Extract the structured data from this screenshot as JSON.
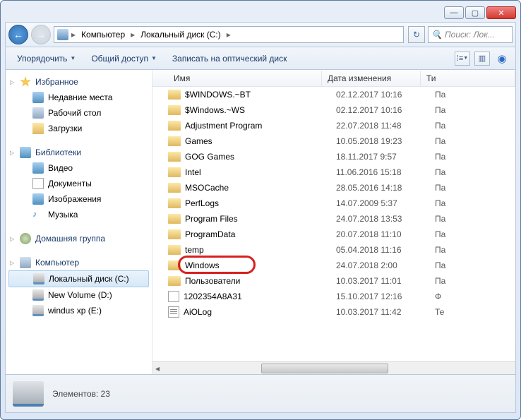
{
  "breadcrumbs": [
    "Компьютер",
    "Локальный диск (C:)"
  ],
  "search_placeholder": "Поиск: Лок...",
  "toolbar": {
    "organize": "Упорядочить",
    "share": "Общий доступ",
    "burn": "Записать на оптический диск"
  },
  "sidebar": {
    "favorites": {
      "label": "Избранное",
      "items": [
        "Недавние места",
        "Рабочий стол",
        "Загрузки"
      ]
    },
    "libraries": {
      "label": "Библиотеки",
      "items": [
        "Видео",
        "Документы",
        "Изображения",
        "Музыка"
      ]
    },
    "homegroup": {
      "label": "Домашняя группа"
    },
    "computer": {
      "label": "Компьютер",
      "items": [
        "Локальный диск (C:)",
        "New Volume (D:)",
        "windus xp (E:)"
      ]
    }
  },
  "columns": {
    "name": "Имя",
    "date": "Дата изменения",
    "type": "Ти"
  },
  "files": [
    {
      "name": "$WINDOWS.~BT",
      "date": "02.12.2017 10:16",
      "type": "Па",
      "icon": "fold"
    },
    {
      "name": "$Windows.~WS",
      "date": "02.12.2017 10:16",
      "type": "Па",
      "icon": "fold"
    },
    {
      "name": "Adjustment Program",
      "date": "22.07.2018 11:48",
      "type": "Па",
      "icon": "fold"
    },
    {
      "name": "Games",
      "date": "10.05.2018 19:23",
      "type": "Па",
      "icon": "fold"
    },
    {
      "name": "GOG Games",
      "date": "18.11.2017 9:57",
      "type": "Па",
      "icon": "fold"
    },
    {
      "name": "Intel",
      "date": "11.06.2016 15:18",
      "type": "Па",
      "icon": "fold"
    },
    {
      "name": "MSOCache",
      "date": "28.05.2016 14:18",
      "type": "Па",
      "icon": "fold"
    },
    {
      "name": "PerfLogs",
      "date": "14.07.2009 5:37",
      "type": "Па",
      "icon": "fold"
    },
    {
      "name": "Program Files",
      "date": "24.07.2018 13:53",
      "type": "Па",
      "icon": "fold"
    },
    {
      "name": "ProgramData",
      "date": "20.07.2018 11:10",
      "type": "Па",
      "icon": "fold"
    },
    {
      "name": "temp",
      "date": "05.04.2018 11:16",
      "type": "Па",
      "icon": "fold"
    },
    {
      "name": "Windows",
      "date": "24.07.2018 2:00",
      "type": "Па",
      "icon": "fold",
      "highlight": true
    },
    {
      "name": "Пользователи",
      "date": "10.03.2017 11:01",
      "type": "Па",
      "icon": "fold"
    },
    {
      "name": "1202354A8A31",
      "date": "15.10.2017 12:16",
      "type": "Ф",
      "icon": "doc"
    },
    {
      "name": "AiOLog",
      "date": "10.03.2017 11:42",
      "type": "Те",
      "icon": "txt"
    }
  ],
  "status": {
    "count_label": "Элементов:",
    "count": "23"
  }
}
